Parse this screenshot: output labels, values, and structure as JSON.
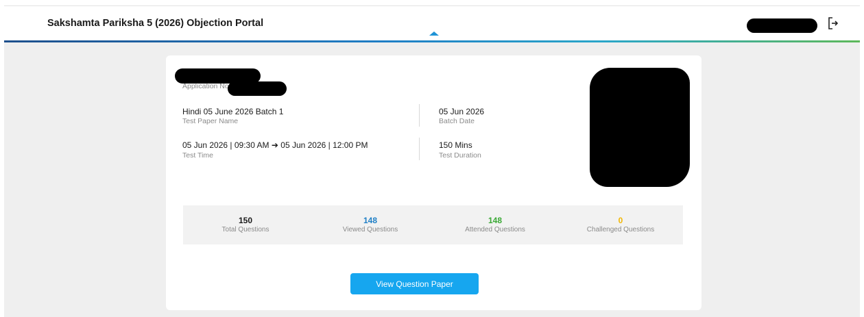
{
  "header": {
    "title": "Sakshamta Pariksha 5 (2026) Objection Portal",
    "caret_icon": "caret-up-icon",
    "logout_icon": "logout-icon"
  },
  "candidate": {
    "application_label": "Application No -"
  },
  "details": {
    "test_paper_name": {
      "value": "Hindi 05 June 2026 Batch 1",
      "label": "Test Paper Name"
    },
    "batch_date": {
      "value": "05 Jun 2026",
      "label": "Batch Date"
    },
    "test_time": {
      "value": "05 Jun 2026 | 09:30 AM ➔ 05 Jun 2026 | 12:00 PM",
      "label": "Test Time"
    },
    "test_duration": {
      "value": "150 Mins",
      "label": "Test Duration"
    }
  },
  "stats": [
    {
      "value": "150",
      "label": "Total Questions",
      "color": "#1a1a1a"
    },
    {
      "value": "148",
      "label": "Viewed Questions",
      "color": "#1f7fc6"
    },
    {
      "value": "148",
      "label": "Attended Questions",
      "color": "#3aa935"
    },
    {
      "value": "0",
      "label": "Challenged Questions",
      "color": "#f2b705"
    }
  ],
  "actions": {
    "view_question_paper": "View Question Paper"
  },
  "colors": {
    "primary_button": "#16a6ef",
    "gradient_start": "#1d4f8c",
    "gradient_end": "#5db85a"
  }
}
